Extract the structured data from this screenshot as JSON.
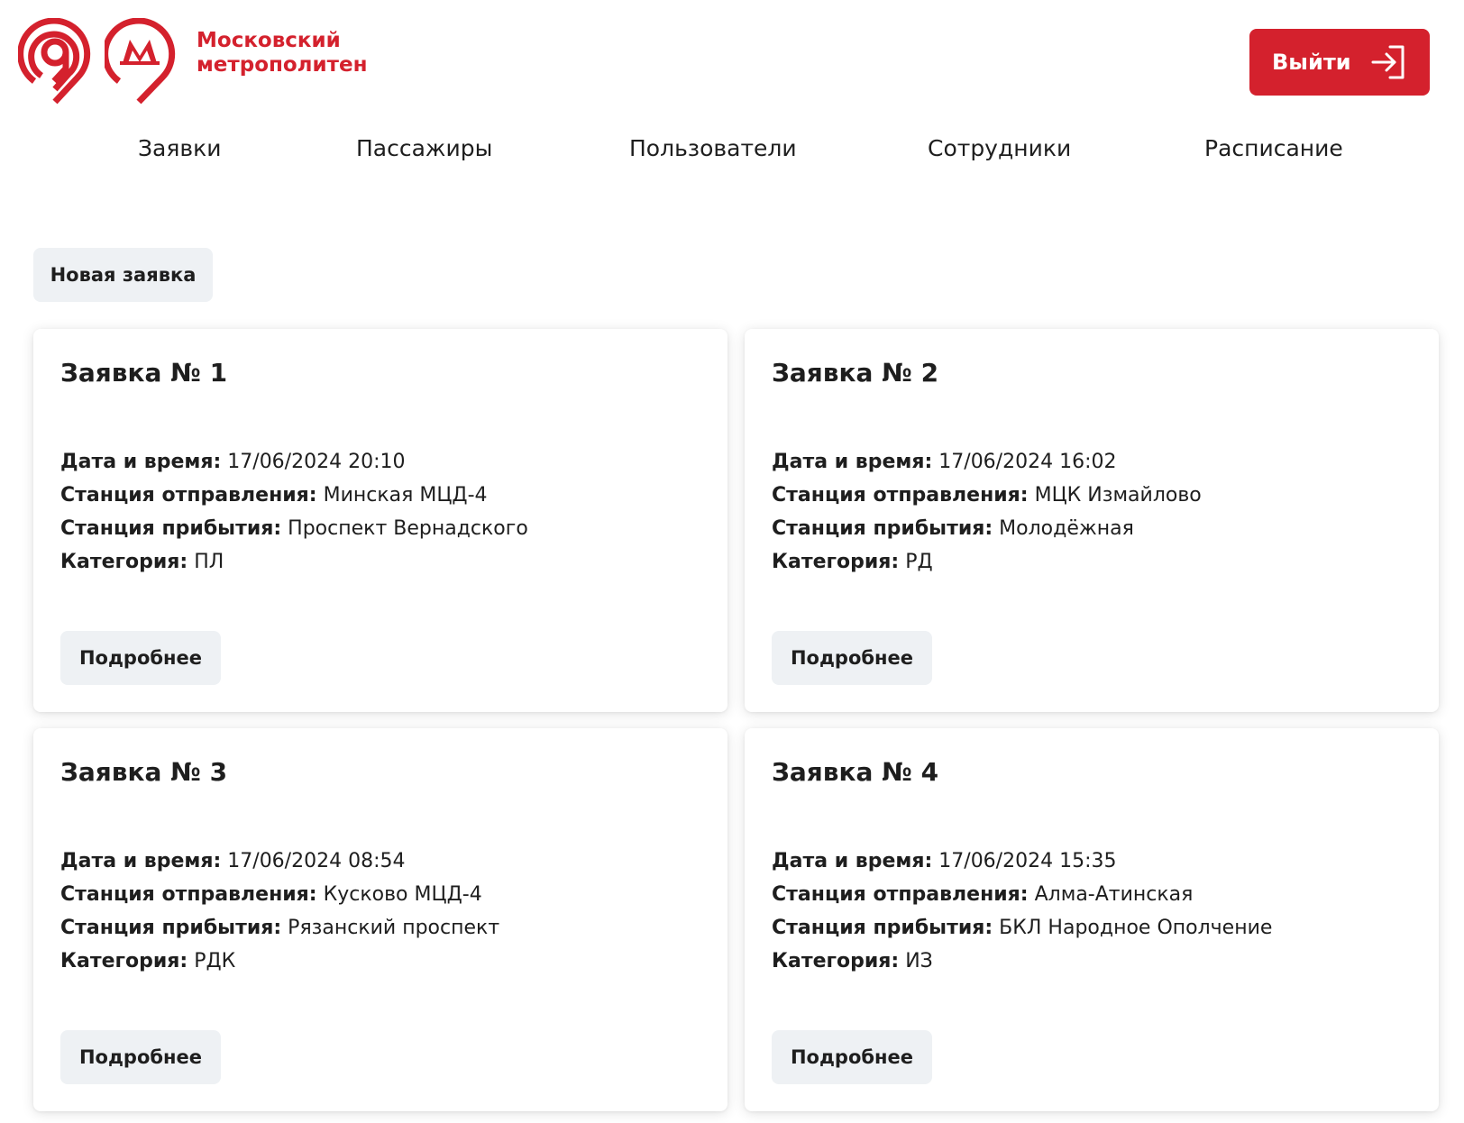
{
  "brand": {
    "line1": "Московский",
    "line2": "метрополитен",
    "color": "#d4212d"
  },
  "header": {
    "logout_label": "Выйти",
    "logout_icon": "logout-arrow-icon"
  },
  "nav": [
    {
      "label": "Заявки"
    },
    {
      "label": "Пассажиры"
    },
    {
      "label": "Пользователи"
    },
    {
      "label": "Сотрудники"
    },
    {
      "label": "Расписание"
    }
  ],
  "actions": {
    "new_request_label": "Новая заявка"
  },
  "field_labels": {
    "datetime": "Дата и время:",
    "from": "Станция отправления:",
    "to": "Станция прибытия:",
    "category": "Категория:"
  },
  "cards": [
    {
      "title": "Заявка № 1",
      "datetime": "17/06/2024 20:10",
      "from": "Минская МЦД-4",
      "to": "Проспект Вернадского",
      "category": "ПЛ",
      "button": "Подробнее"
    },
    {
      "title": "Заявка № 2",
      "datetime": "17/06/2024 16:02",
      "from": "МЦК Измайлово",
      "to": "Молодёжная",
      "category": "РД",
      "button": "Подробнее"
    },
    {
      "title": "Заявка № 3",
      "datetime": "17/06/2024 08:54",
      "from": "Кусково МЦД-4",
      "to": "Рязанский проспект",
      "category": "РДК",
      "button": "Подробнее"
    },
    {
      "title": "Заявка № 4",
      "datetime": "17/06/2024 15:35",
      "from": "Алма-Атинская",
      "to": "БКЛ Народное Ополчение",
      "category": "ИЗ",
      "button": "Подробнее"
    }
  ]
}
